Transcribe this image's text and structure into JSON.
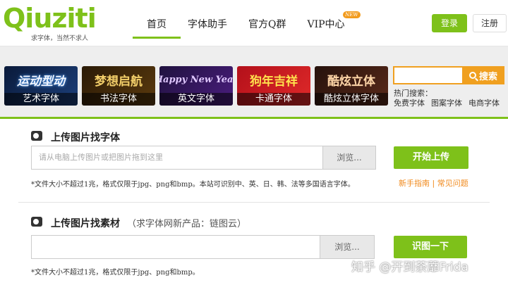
{
  "header": {
    "logo_text": "Qiuziti",
    "slogan": "求字体，当然不求人",
    "nav": [
      {
        "label": "首页"
      },
      {
        "label": "字体助手"
      },
      {
        "label": "官方Q群"
      },
      {
        "label": "VIP中心"
      }
    ],
    "new_badge": "NEW",
    "login": "登录",
    "register": "注册"
  },
  "categories": [
    {
      "art": "运动型动",
      "label": "艺术字体"
    },
    {
      "art": "梦想启航",
      "label": "书法字体"
    },
    {
      "art": "Happy New Year",
      "label": "英文字体"
    },
    {
      "art": "狗年吉祥",
      "label": "卡通字体"
    },
    {
      "art": "酷炫立体",
      "label": "酷炫立体字体"
    }
  ],
  "search": {
    "placeholder": "",
    "button": "搜索",
    "hot_title": "热门搜索：",
    "hot_links": [
      "免费字体",
      "图案字体",
      "电商字体"
    ]
  },
  "upload_font": {
    "title": "上传图片找字体",
    "placeholder": "请从电脑上传图片或把图片拖到这里",
    "browse": "浏览...",
    "go": "开始上传",
    "note": "*文件大小不超过1兆，格式仅限于jpg、png和bmp。本站可识别中、英、日、韩、法等多国语言字体。",
    "guide": "新手指南",
    "sep": "|",
    "faq": "常见问题"
  },
  "upload_material": {
    "title": "上传图片找素材",
    "subtitle": "（求字体网新产品：链图云）",
    "placeholder": "",
    "browse": "浏览...",
    "go": "识图一下",
    "note": "*文件大小不超过1兆，格式仅限于jpg、png和bmp。"
  },
  "watermark": "知乎 @开到荼蘼Frida",
  "colors": {
    "brand": "#7ec11a",
    "accent": "#f0a020"
  }
}
